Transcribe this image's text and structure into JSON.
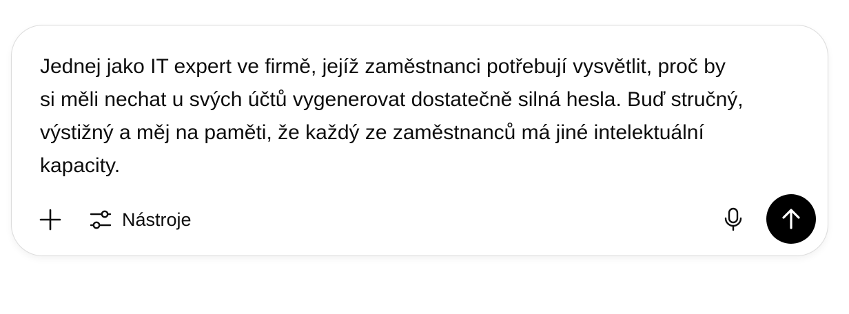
{
  "composer": {
    "prompt_text": "Jednej jako IT expert ve firmě, jejíž zaměstnanci potřebují vysvětlit, proč by\nsi měli nechat u svých účtů vygenerovat dostatečně silná hesla. Buď stručný,\nvýstižný a měj na paměti, že každý ze zaměstnanců má jiné intelektuální\nkapacity.",
    "toolbar": {
      "add_icon": "plus-icon",
      "tools_icon": "sliders-icon",
      "tools_label": "Nástroje",
      "mic_icon": "microphone-icon",
      "send_icon": "arrow-up-icon"
    },
    "colors": {
      "send_button": "#000000",
      "text": "#0d0d0d",
      "border": "#dcdcdc"
    }
  }
}
